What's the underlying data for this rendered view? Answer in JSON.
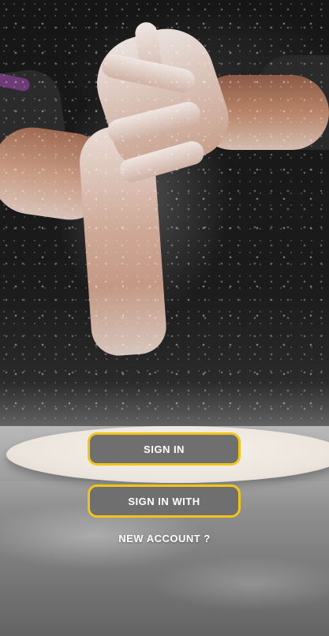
{
  "background": {
    "image_subject": "flour-dusted-hands-over-pizza-dough"
  },
  "actions": {
    "sign_in_label": "SIGN IN",
    "sign_in_with_label": "SIGN IN WITH",
    "new_account_label": "NEW ACCOUNT ?"
  },
  "colors": {
    "button_fill": "#6f6f6f",
    "button_border": "#f2c419",
    "button_text": "#ffffff"
  }
}
